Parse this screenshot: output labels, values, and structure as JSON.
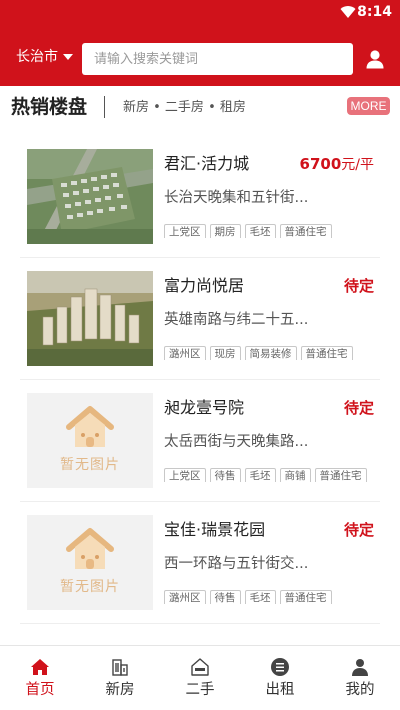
{
  "status_bar": {
    "time": "8:14"
  },
  "header": {
    "city": "长治市",
    "search_placeholder": "请输入搜索关键词"
  },
  "section": {
    "title": "热销楼盘",
    "subtitle": "新房 • 二手房 • 租房",
    "more_label": "MORE"
  },
  "listings": [
    {
      "name": "君汇·活力城",
      "price_value": "6700",
      "price_unit": "元/平",
      "address": "长治天晚集和五针街...",
      "image": "aerial-render",
      "tags": [
        "上党区",
        "期房",
        "毛坯",
        "普通住宅"
      ]
    },
    {
      "name": "富力尚悦居",
      "price_value": "待定",
      "price_unit": "",
      "address": "英雄南路与纬二十五...",
      "image": "highrise-render",
      "tags": [
        "潞州区",
        "现房",
        "简易装修",
        "普通住宅"
      ]
    },
    {
      "name": "昶龙壹号院",
      "price_value": "待定",
      "price_unit": "",
      "address": "太岳西街与天晚集路...",
      "image": "no-image",
      "no_image_text": "暂无图片",
      "tags": [
        "上党区",
        "待售",
        "毛坯",
        "商铺",
        "普通住宅"
      ]
    },
    {
      "name": "宝佳·瑞景花园",
      "price_value": "待定",
      "price_unit": "",
      "address": "西一环路与五针街交...",
      "image": "no-image",
      "no_image_text": "暂无图片",
      "tags": [
        "潞州区",
        "待售",
        "毛坯",
        "普通住宅"
      ]
    }
  ],
  "tabbar": {
    "active": "home",
    "tabs": [
      {
        "id": "home",
        "label": "首页",
        "icon": "home-icon"
      },
      {
        "id": "new",
        "label": "新房",
        "icon": "building-icon"
      },
      {
        "id": "second",
        "label": "二手",
        "icon": "sale-house-icon"
      },
      {
        "id": "rent",
        "label": "出租",
        "icon": "rent-icon"
      },
      {
        "id": "mine",
        "label": "我的",
        "icon": "person-icon"
      }
    ]
  },
  "colors": {
    "brand_red": "#d0121b",
    "more_badge": "#e8727b",
    "placeholder_orange": "#e2b98a"
  }
}
